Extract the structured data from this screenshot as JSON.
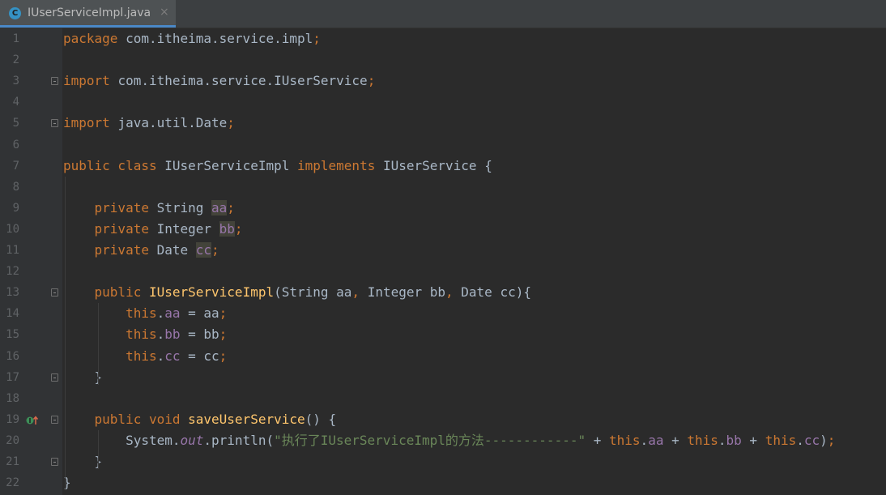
{
  "tab": {
    "file_icon": "C",
    "file_name": "IUserServiceImpl.java",
    "close_glyph": "×"
  },
  "gutter": {
    "line_numbers": [
      "1",
      "2",
      "3",
      "4",
      "5",
      "6",
      "7",
      "8",
      "9",
      "10",
      "11",
      "12",
      "13",
      "14",
      "15",
      "16",
      "17",
      "18",
      "19",
      "20",
      "21",
      "22"
    ],
    "markers": {
      "line19": "implements-method-icon"
    }
  },
  "code": {
    "l1": [
      [
        "kw",
        "package "
      ],
      [
        "",
        "com.itheima.service.impl"
      ],
      [
        "kw",
        ";"
      ]
    ],
    "l2": [],
    "l3": [
      [
        "kw",
        "import "
      ],
      [
        "",
        "com.itheima.service.IUserService"
      ],
      [
        "kw",
        ";"
      ]
    ],
    "l4": [],
    "l5": [
      [
        "kw",
        "import "
      ],
      [
        "",
        "java.util.Date"
      ],
      [
        "kw",
        ";"
      ]
    ],
    "l6": [],
    "l7": [
      [
        "kw",
        "public class "
      ],
      [
        "",
        "IUserServiceImpl "
      ],
      [
        "kw",
        "implements "
      ],
      [
        "",
        "IUserService {"
      ]
    ],
    "l8": [],
    "l9": [
      [
        "",
        "    "
      ],
      [
        "kw",
        "private "
      ],
      [
        "",
        "String "
      ],
      [
        "fld hl",
        "aa"
      ],
      [
        "kw",
        ";"
      ]
    ],
    "l10": [
      [
        "",
        "    "
      ],
      [
        "kw",
        "private "
      ],
      [
        "",
        "Integer "
      ],
      [
        "fld hl",
        "bb"
      ],
      [
        "kw",
        ";"
      ]
    ],
    "l11": [
      [
        "",
        "    "
      ],
      [
        "kw",
        "private "
      ],
      [
        "",
        "Date "
      ],
      [
        "fld hl",
        "cc"
      ],
      [
        "kw",
        ";"
      ]
    ],
    "l12": [],
    "l13": [
      [
        "",
        "    "
      ],
      [
        "kw",
        "public "
      ],
      [
        "fn",
        "IUserServiceImpl"
      ],
      [
        "",
        "(String aa"
      ],
      [
        "kw",
        ", "
      ],
      [
        "",
        "Integer bb"
      ],
      [
        "kw",
        ", "
      ],
      [
        "",
        "Date cc){"
      ]
    ],
    "l14": [
      [
        "",
        "        "
      ],
      [
        "kw",
        "this"
      ],
      [
        "",
        "."
      ],
      [
        "fld",
        "aa"
      ],
      [
        "",
        " = aa"
      ],
      [
        "kw",
        ";"
      ]
    ],
    "l15": [
      [
        "",
        "        "
      ],
      [
        "kw",
        "this"
      ],
      [
        "",
        "."
      ],
      [
        "fld",
        "bb"
      ],
      [
        "",
        " = bb"
      ],
      [
        "kw",
        ";"
      ]
    ],
    "l16": [
      [
        "",
        "        "
      ],
      [
        "kw",
        "this"
      ],
      [
        "",
        "."
      ],
      [
        "fld",
        "cc"
      ],
      [
        "",
        " = cc"
      ],
      [
        "kw",
        ";"
      ]
    ],
    "l17": [
      [
        "",
        "    }"
      ]
    ],
    "l18": [],
    "l19": [
      [
        "",
        "    "
      ],
      [
        "kw",
        "public void "
      ],
      [
        "fn",
        "saveUserService"
      ],
      [
        "",
        "() {"
      ]
    ],
    "l20": [
      [
        "",
        "        System."
      ],
      [
        "it",
        "out"
      ],
      [
        "",
        ".println("
      ],
      [
        "str",
        "\"执行了IUserServiceImpl的方法------------\""
      ],
      [
        "",
        " + "
      ],
      [
        "kw",
        "this"
      ],
      [
        "",
        "."
      ],
      [
        "fld",
        "aa"
      ],
      [
        "",
        " + "
      ],
      [
        "kw",
        "this"
      ],
      [
        "",
        "."
      ],
      [
        "fld",
        "bb"
      ],
      [
        "",
        " + "
      ],
      [
        "kw",
        "this"
      ],
      [
        "",
        "."
      ],
      [
        "fld",
        "cc"
      ],
      [
        "",
        ")"
      ],
      [
        "kw",
        ";"
      ]
    ],
    "l21": [
      [
        "",
        "    }"
      ]
    ],
    "l22": [
      [
        "",
        "}"
      ]
    ]
  },
  "colors": {
    "background": "#2b2b2b",
    "gutter": "#313335",
    "keyword": "#cc7832",
    "field": "#9876aa",
    "method": "#ffc66d",
    "string": "#6a8759",
    "text": "#a9b7c6",
    "line_number": "#606366"
  }
}
